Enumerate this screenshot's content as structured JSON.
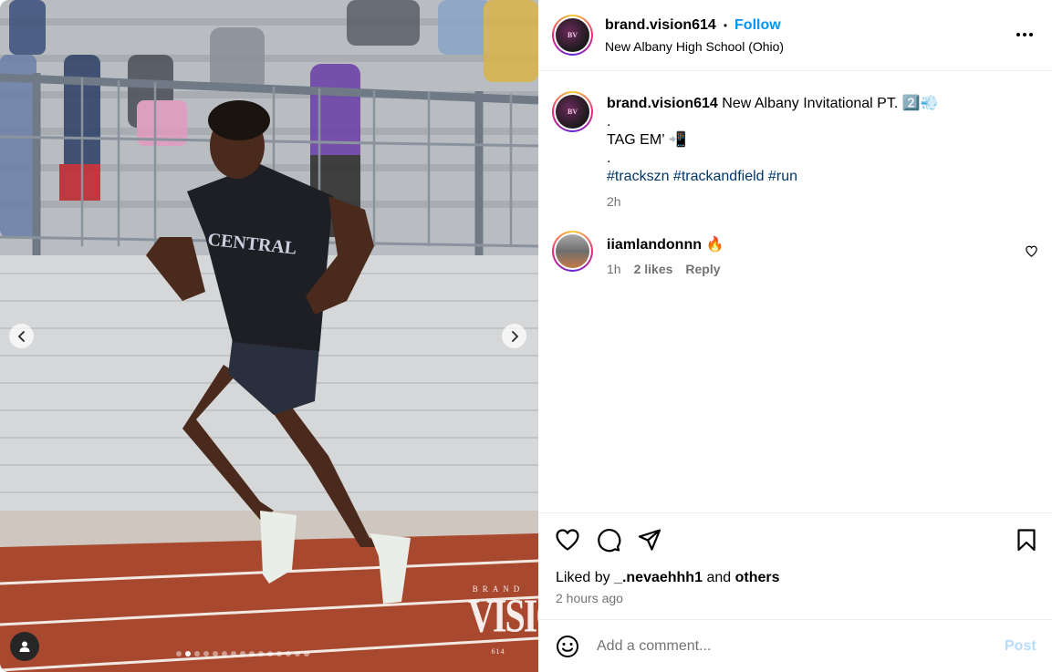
{
  "post": {
    "username": "brand.vision614",
    "follow_label": "Follow",
    "separator": "•",
    "location": "New Albany High School (Ohio)",
    "avatar_text": "BV",
    "caption_title": "New Albany Invitational PT. 2️⃣💨",
    "caption_dot1": ".",
    "caption_line2": "TAG EM’ 📲",
    "caption_dot2": ".",
    "hashtags": [
      "#trackszn",
      "#trackandfield",
      "#run"
    ],
    "caption_time": "2h"
  },
  "comment": {
    "username": "iiamlandonnn",
    "text": "🔥",
    "time": "1h",
    "likes": "2 likes",
    "reply_label": "Reply"
  },
  "likes": {
    "prefix": "Liked by",
    "user": "_.nevaehhh1",
    "conjunction": "and",
    "others": "others",
    "posted_ago": "2 hours ago"
  },
  "composer": {
    "placeholder": "Add a comment...",
    "post_label": "Post"
  },
  "media": {
    "jersey_text": "CENTRAL",
    "watermark_top": "BRAND",
    "watermark_main": "VISION",
    "watermark_num": "614",
    "carousel_count": 15,
    "carousel_active_index": 1
  },
  "icons": {
    "more": "more-horizontal-icon",
    "like": "heart-icon",
    "comment": "comment-icon",
    "share": "share-icon",
    "save": "bookmark-icon",
    "emoji": "emoji-icon",
    "tag": "user-tag-icon"
  },
  "colors": {
    "accent": "#0095f6",
    "hashtag": "#00376b",
    "muted": "#737373",
    "post_disabled": "#b6dcfc"
  }
}
